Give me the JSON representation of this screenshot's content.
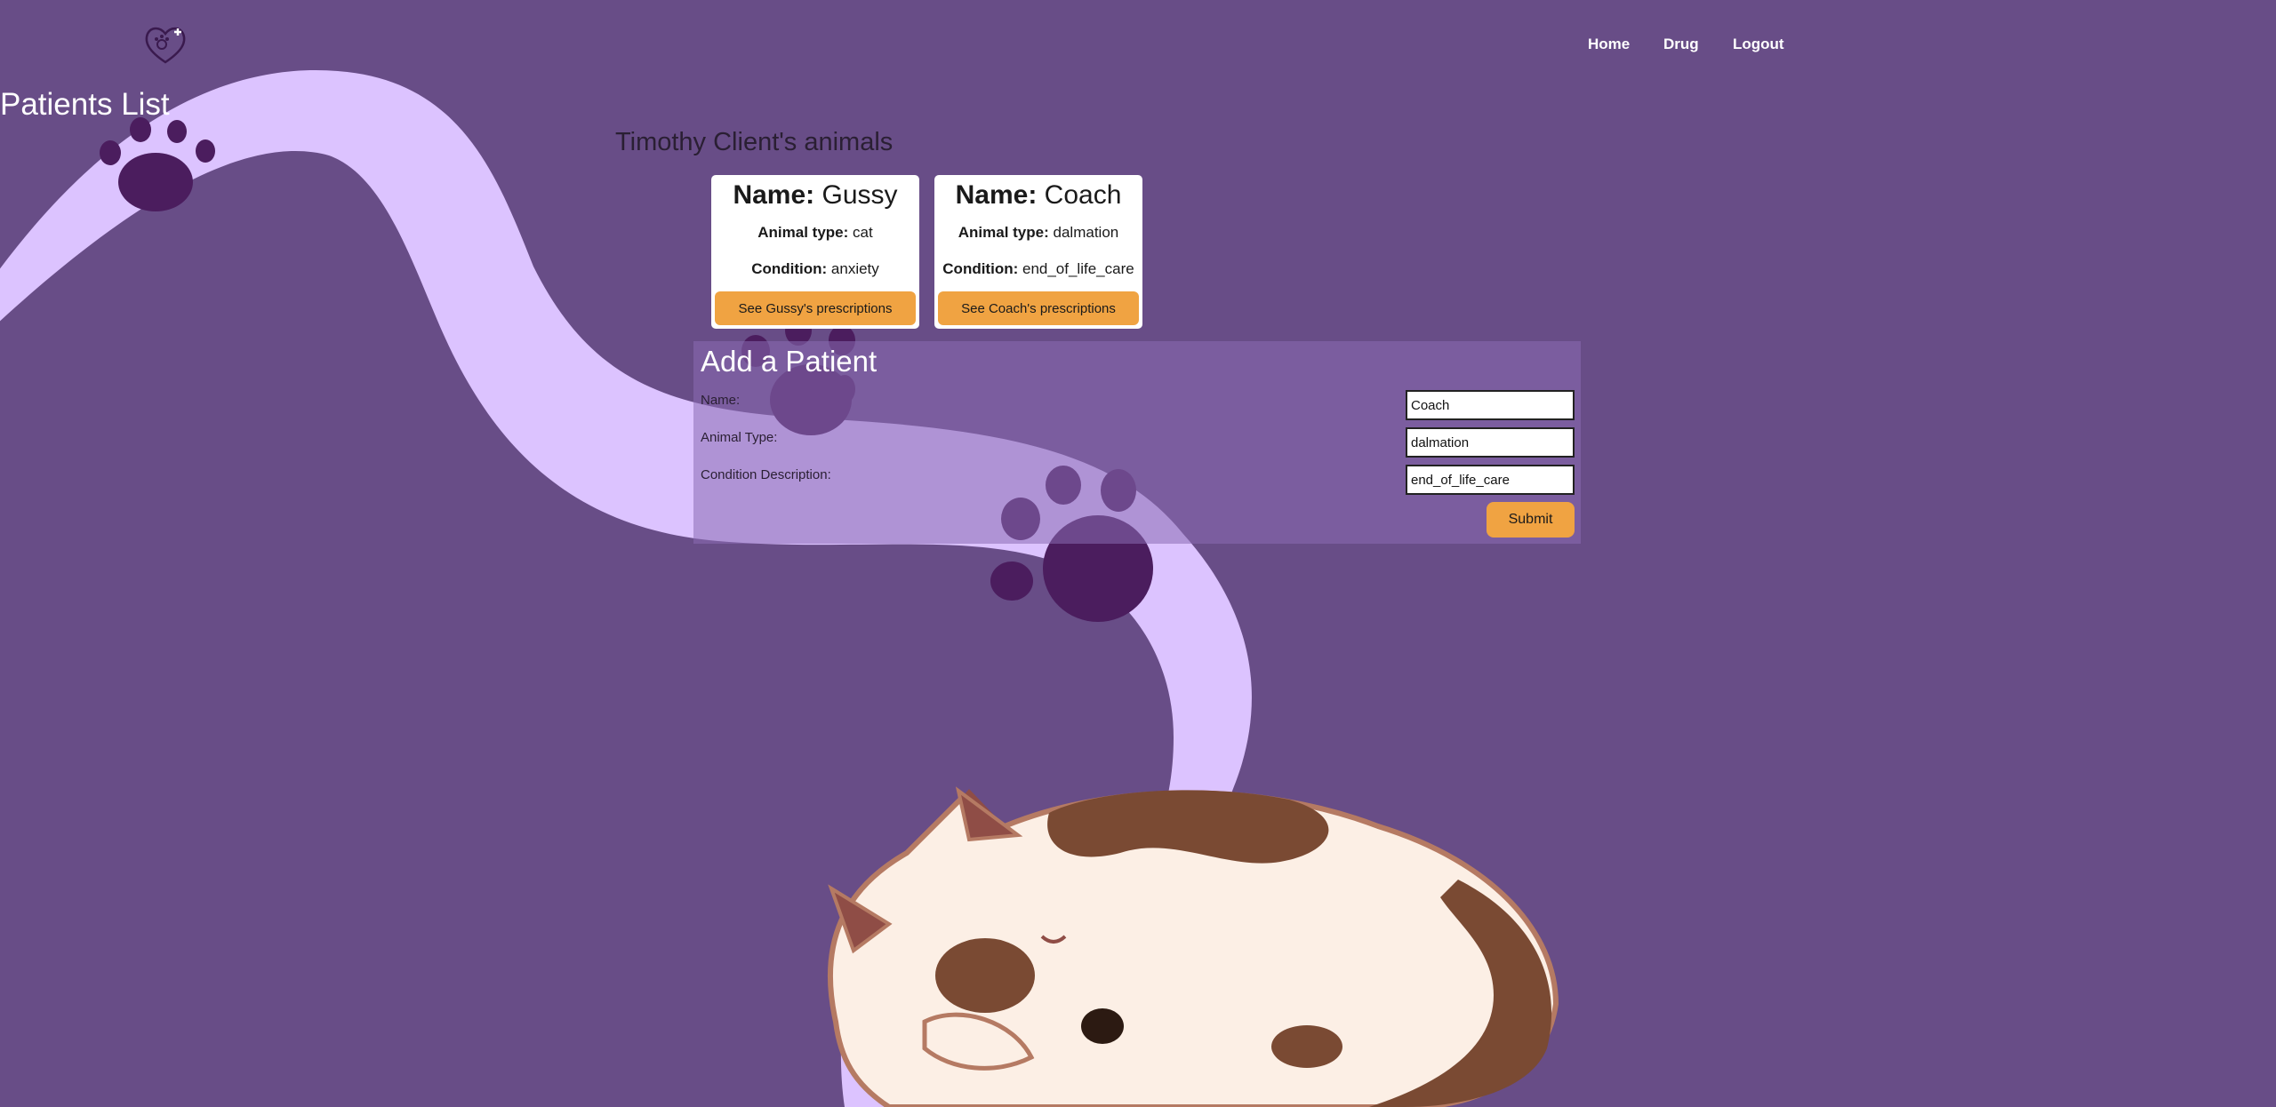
{
  "nav": {
    "home": "Home",
    "drug": "Drug",
    "logout": "Logout"
  },
  "page_title": "Patients List",
  "client_heading": "Timothy Client's animals",
  "animals": [
    {
      "name_label": "Name:",
      "name": "Gussy",
      "type_label": "Animal type:",
      "type": "cat",
      "condition_label": "Condition:",
      "condition": "anxiety",
      "button": "See Gussy's prescriptions"
    },
    {
      "name_label": "Name:",
      "name": "Coach",
      "type_label": "Animal type:",
      "type": "dalmation",
      "condition_label": "Condition:",
      "condition": "end_of_life_care",
      "button": "See Coach's prescriptions"
    }
  ],
  "add_patient": {
    "title": "Add a Patient",
    "name_label": "Name:",
    "type_label": "Animal Type:",
    "condition_label": "Condition Description:",
    "name_value": "Coach",
    "type_value": "dalmation",
    "condition_value": "end_of_life_care",
    "submit": "Submit"
  },
  "colors": {
    "background": "#684d87",
    "accent": "#f0a342",
    "stripe": "#dcc3ff",
    "paw": "#4b1d5e"
  },
  "icons": {
    "logo": "heart-paw-plus-icon"
  }
}
